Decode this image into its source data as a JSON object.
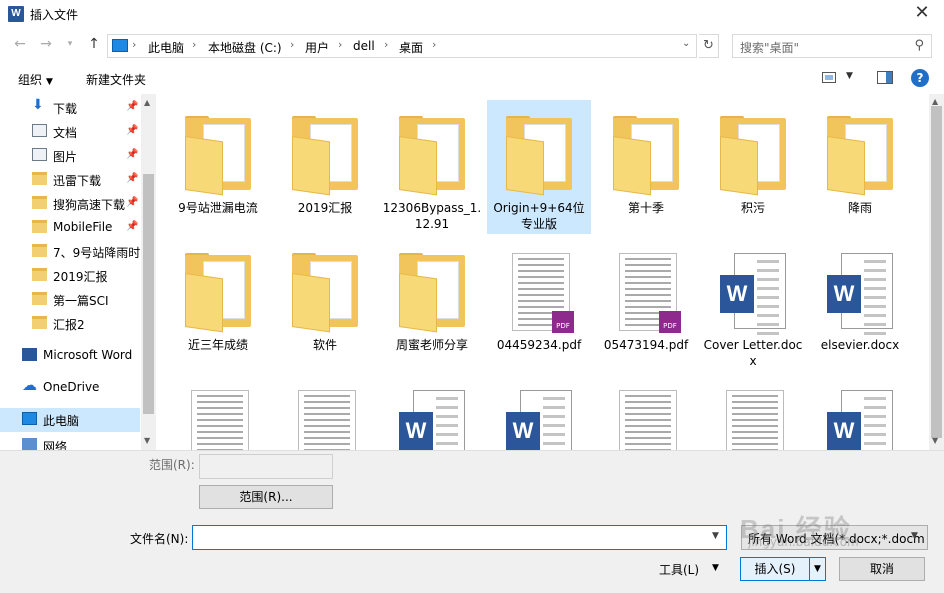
{
  "window": {
    "title": "插入文件",
    "app_icon": "W"
  },
  "address": {
    "crumbs": [
      "此电脑",
      "本地磁盘 (C:)",
      "用户",
      "dell",
      "桌面"
    ],
    "search_placeholder": "搜索\"桌面\""
  },
  "toolbar": {
    "organize": "组织",
    "new_folder": "新建文件夹",
    "help": "?"
  },
  "nav": {
    "items": [
      {
        "label": "下载",
        "icon": "download-icon",
        "pinned": true
      },
      {
        "label": "文档",
        "icon": "document-icon",
        "pinned": true
      },
      {
        "label": "图片",
        "icon": "picture-icon",
        "pinned": true
      },
      {
        "label": "迅雷下载",
        "icon": "folder-icon",
        "pinned": true
      },
      {
        "label": "搜狗高速下载",
        "icon": "folder-icon",
        "pinned": true
      },
      {
        "label": "MobileFile",
        "icon": "folder-icon",
        "pinned": true
      },
      {
        "label": "7、9号站降雨时",
        "icon": "folder-icon",
        "pinned": false
      },
      {
        "label": "2019汇报",
        "icon": "folder-icon",
        "pinned": false
      },
      {
        "label": "第一篇SCI",
        "icon": "folder-icon",
        "pinned": false
      },
      {
        "label": "汇报2",
        "icon": "folder-icon",
        "pinned": false
      },
      {
        "label": "Microsoft Word",
        "icon": "word-icon",
        "pinned": false
      },
      {
        "label": "OneDrive",
        "icon": "cloud-icon",
        "pinned": false
      },
      {
        "label": "此电脑",
        "icon": "pc-icon",
        "pinned": false,
        "selected": true
      },
      {
        "label": "网络",
        "icon": "network-icon",
        "pinned": false
      }
    ]
  },
  "files": [
    {
      "name": "9号站泄漏电流",
      "kind": "folder"
    },
    {
      "name": "2019汇报",
      "kind": "folder"
    },
    {
      "name": "12306Bypass_1.12.91",
      "kind": "folder"
    },
    {
      "name": "Origin+9+64位专业版",
      "kind": "folder",
      "selected": true
    },
    {
      "name": "第十季",
      "kind": "folder"
    },
    {
      "name": "积污",
      "kind": "folder"
    },
    {
      "name": "降雨",
      "kind": "folder"
    },
    {
      "name": "近三年成绩",
      "kind": "folder"
    },
    {
      "name": "软件",
      "kind": "folder"
    },
    {
      "name": "周蜜老师分享",
      "kind": "folder"
    },
    {
      "name": "04459234.pdf",
      "kind": "pdf"
    },
    {
      "name": "05473194.pdf",
      "kind": "pdf"
    },
    {
      "name": "Cover Letter.docx",
      "kind": "word"
    },
    {
      "name": "elsevier.docx",
      "kind": "word"
    },
    {
      "name": "",
      "kind": "doc"
    },
    {
      "name": "",
      "kind": "doc"
    },
    {
      "name": "",
      "kind": "word"
    },
    {
      "name": "",
      "kind": "word"
    },
    {
      "name": "",
      "kind": "doc"
    },
    {
      "name": "",
      "kind": "doc"
    },
    {
      "name": "",
      "kind": "word"
    }
  ],
  "bottom": {
    "range_label": "范围(R):",
    "range_button": "范围(R)...",
    "filename_label": "文件名(N):",
    "filename_value": "",
    "filetype": "所有 Word 文档(*.docx;*.docm",
    "tools": "工具(L)",
    "insert": "插入(S)",
    "cancel": "取消"
  },
  "watermark": {
    "text": "Bai 经验",
    "sub": "jingyan.baidu.com"
  },
  "colors": {
    "selection": "#cce8ff",
    "accent": "#0078d7",
    "word": "#2b579a",
    "pdf": "#8e2a8d",
    "folder": "#f2c55c"
  }
}
